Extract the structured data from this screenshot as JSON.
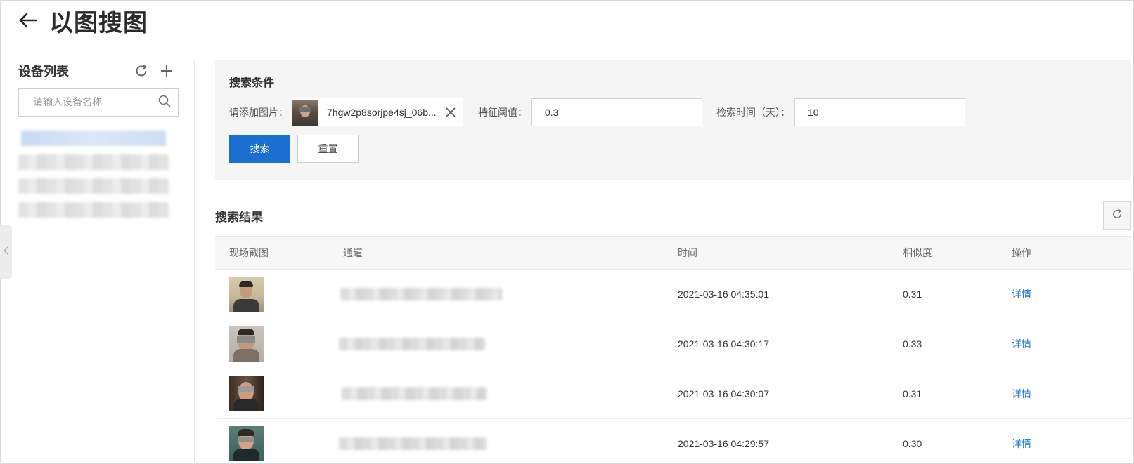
{
  "header": {
    "title": "以图搜图",
    "back_icon": "arrow-left-icon"
  },
  "sidebar": {
    "title": "设备列表",
    "search_placeholder": "请输入设备名称",
    "items": [
      {
        "label": "",
        "active": true
      },
      {
        "label": "",
        "active": false
      },
      {
        "label": "",
        "active": false
      },
      {
        "label": "",
        "active": false
      }
    ]
  },
  "search_panel": {
    "title": "搜索条件",
    "image_label": "请添加图片：",
    "image_name": "7hgw2p8sorjpe4sj_06b...",
    "threshold_label": "特征阈值：",
    "threshold_value": "0.3",
    "days_label": "检索时间（天）：",
    "days_value": "10",
    "search_button": "搜索",
    "reset_button": "重置"
  },
  "results": {
    "title": "搜索结果",
    "columns": [
      "现场截图",
      "通道",
      "时间",
      "相似度",
      "操作"
    ],
    "rows": [
      {
        "time": "2021-03-16 04:35:01",
        "similarity": "0.31",
        "action": "详情"
      },
      {
        "time": "2021-03-16 04:30:17",
        "similarity": "0.33",
        "action": "详情"
      },
      {
        "time": "2021-03-16 04:30:07",
        "similarity": "0.31",
        "action": "详情"
      },
      {
        "time": "2021-03-16 04:29:57",
        "similarity": "0.30",
        "action": "详情"
      }
    ]
  },
  "colors": {
    "primary": "#1a6fd1",
    "link": "#1a73d1",
    "panel_bg": "#f5f5f5"
  }
}
